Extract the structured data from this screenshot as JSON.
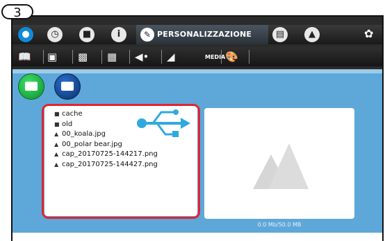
{
  "step_badge": "3",
  "toolbar": {
    "icons": [
      "drop-icon",
      "clock-icon",
      "folder-icon",
      "info-icon",
      "pen-icon",
      "book-icon",
      "printer-icon",
      "wrench-icon"
    ],
    "active_tab_label": "PERSONALIZZAZIONE"
  },
  "subtoolbar": {
    "icons": [
      "book-open-icon",
      "book-icon",
      "image-icon",
      "picture-frame-icon",
      "speaker-icon",
      "media-icon",
      "palette-icon"
    ],
    "media_label": "MEDIA"
  },
  "media_buttons": [
    "images-icon",
    "video-camera-icon"
  ],
  "files": [
    {
      "type": "folder",
      "name": "cache"
    },
    {
      "type": "folder",
      "name": "old"
    },
    {
      "type": "image",
      "name": "00_koala.jpg"
    },
    {
      "type": "image",
      "name": "00_polar bear.jpg"
    },
    {
      "type": "image",
      "name": "cap_20170725-144217.png"
    },
    {
      "type": "image",
      "name": "cap_20170725-144427.png"
    }
  ],
  "storage_text": "0.0 Mb/50.0 MB",
  "colors": {
    "content_bg": "#5ea7d9",
    "highlight": "#e3232e",
    "usb_icon": "#2fa9e0",
    "toolbar_bg": "#1a1a1a"
  }
}
